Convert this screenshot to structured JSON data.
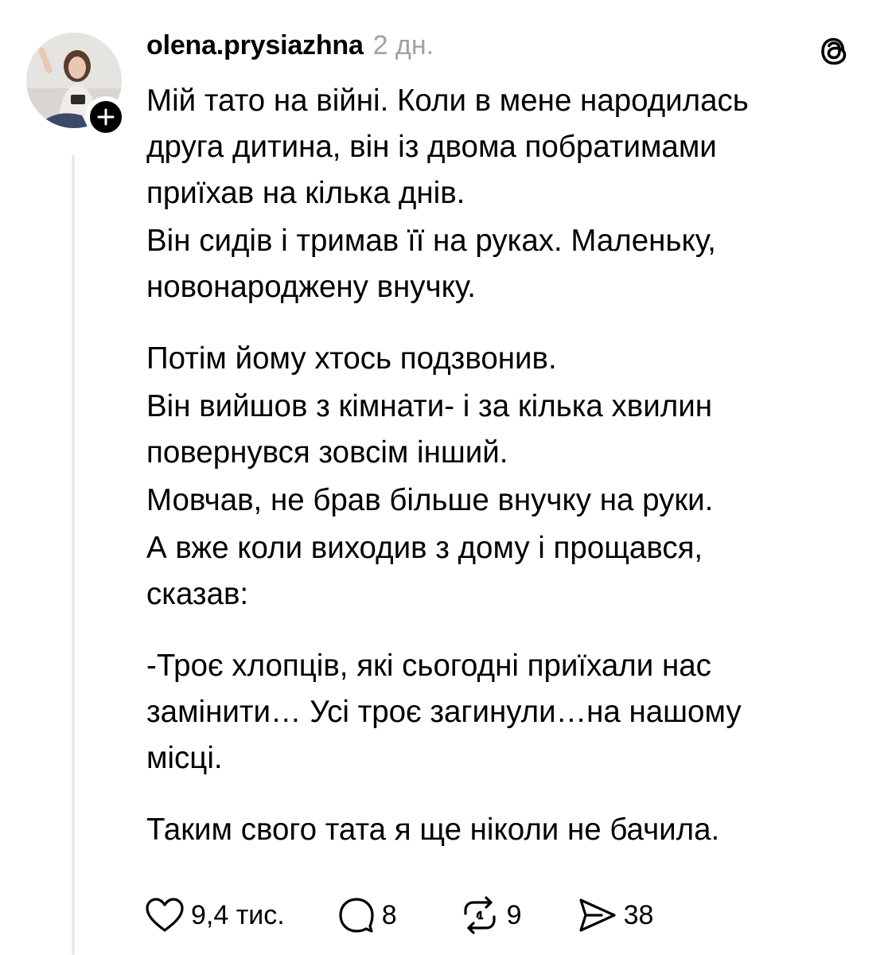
{
  "post": {
    "username": "olena.prysiazhna",
    "timestamp": "2 дн.",
    "paragraphs": [
      [
        "Мій тато на війні. Коли в мене народилась",
        "друга дитина, він із двома побратимами",
        "приїхав на кілька днів."
      ],
      [
        "Він сидів і тримав її на руках. Маленьку,",
        "новонароджену внучку."
      ],
      [
        "Потім йому хтось подзвонив."
      ],
      [
        "Він вийшов з кімнати- і за кілька хвилин",
        "повернувся зовсім інший."
      ],
      [
        "Мовчав, не брав більше внучку на руки."
      ],
      [
        "А вже коли виходив з дому і прощався,",
        "сказав:"
      ],
      [
        "-Троє хлопців, які сьогодні приїхали нас",
        "замінити… Усі троє загинули…на нашому",
        "місці."
      ],
      [
        "Таким свого тата я ще ніколи не бачила."
      ]
    ]
  },
  "actions": {
    "likes": "9,4 тис.",
    "comments": "8",
    "reposts": "9",
    "shares": "38"
  },
  "icons": {
    "like": "heart-icon",
    "comment": "speech-bubble-icon",
    "repost": "repost-icon",
    "share": "send-icon",
    "app": "threads-logo-icon",
    "follow": "plus-icon"
  },
  "colors": {
    "text": "#000000",
    "muted": "#a2a2a2",
    "thread_line": "#e9e9e9",
    "background": "#ffffff"
  }
}
